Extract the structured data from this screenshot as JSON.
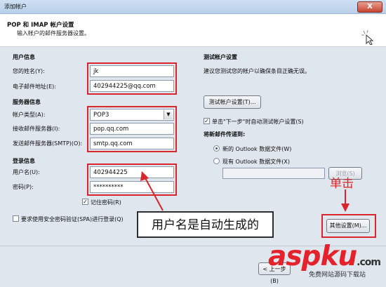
{
  "window": {
    "title": "添加帐户",
    "close_label": "X"
  },
  "header": {
    "title": "POP 和 IMAP 帐户设置",
    "subtitle": "输入帐户的邮件服务器设置。"
  },
  "user_info": {
    "section": "用户信息",
    "name_label": "您的姓名(Y):",
    "name_value": "jk",
    "email_label": "电子邮件地址(E):",
    "email_value": "402944225@qq.com"
  },
  "server_info": {
    "section": "服务器信息",
    "type_label": "帐户类型(A):",
    "type_value": "POP3",
    "incoming_label": "接收邮件服务器(I):",
    "incoming_value": "pop.qq.com",
    "outgoing_label": "发送邮件服务器(SMTP)(O):",
    "outgoing_value": "smtp.qq.com"
  },
  "login_info": {
    "section": "登录信息",
    "user_label": "用户名(U):",
    "user_value": "402944225",
    "password_label": "密码(P):",
    "password_value": "**********",
    "remember_label": "记住密码(R)",
    "spa_label": "要求使用安全密码验证(SPA)进行登录(Q)"
  },
  "test": {
    "section": "测试帐户设置",
    "desc": "建议您测试您的帐户以确保条目正确无误。",
    "button": "测试帐户设置(T)...",
    "auto_label": "单击\"下一步\"时自动测试帐户设置(S)"
  },
  "deliver": {
    "section": "将新邮件传递到:",
    "opt_new": "新的 Outlook 数据文件(W)",
    "opt_existing": "现有 Outlook 数据文件(X)",
    "browse": "浏览(S)"
  },
  "buttons": {
    "more_settings": "其他设置(M)...",
    "back": "< 上一步(B)"
  },
  "annotations": {
    "callout": "用户名是自动生成的",
    "click": "单击"
  },
  "watermark": {
    "brand": "aspku",
    "tld": ".com",
    "sub": "免费网站源码下载站"
  }
}
